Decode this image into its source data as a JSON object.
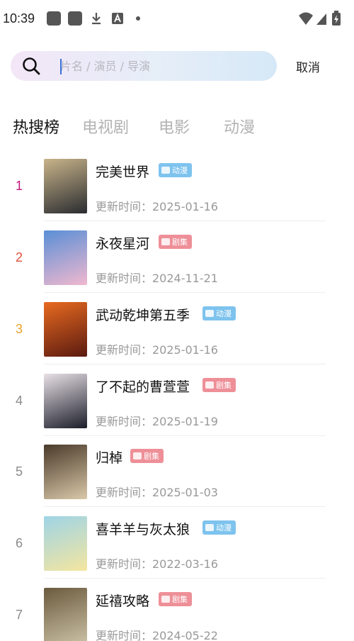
{
  "status_bar": {
    "time": "10:39",
    "icons": [
      "app-square-icon",
      "app-square-icon",
      "download-icon",
      "translate-icon",
      "dot-icon",
      "wifi-icon",
      "signal-icon",
      "battery-icon"
    ]
  },
  "search": {
    "placeholder": "片名 / 演员 / 导演",
    "value": "",
    "cancel_label": "取消"
  },
  "tabs": [
    {
      "label": "热搜榜",
      "active": true
    },
    {
      "label": "电视剧",
      "active": false
    },
    {
      "label": "电影",
      "active": false
    },
    {
      "label": "动漫",
      "active": false
    }
  ],
  "colors": {
    "rank_1": "#c2187a",
    "rank_2": "#e0503a",
    "rank_3": "#eba331",
    "rank_other": "#8a8a8a",
    "badge_anime": "#7ec3ee",
    "badge_series": "#ee8f98"
  },
  "items": [
    {
      "rank": "1",
      "title": "完美世界",
      "badge": "动漫",
      "badge_type": "anime",
      "updated": "更新时间：2025-01-16",
      "poster_colors": [
        "#2a2c30",
        "#c9b48a"
      ]
    },
    {
      "rank": "2",
      "title": "永夜星河",
      "badge": "剧集",
      "badge_type": "series",
      "updated": "更新时间：2024-11-21",
      "poster_colors": [
        "#f0b8cf",
        "#5a8fd6"
      ]
    },
    {
      "rank": "3",
      "title": "武动乾坤第五季",
      "badge": "动漫",
      "badge_type": "anime",
      "updated": "更新时间：2025-01-16",
      "poster_colors": [
        "#5a1a10",
        "#e86a20"
      ]
    },
    {
      "rank": "4",
      "title": "了不起的曹萱萱",
      "badge": "剧集",
      "badge_type": "series",
      "updated": "更新时间：2025-01-19",
      "poster_colors": [
        "#1c1e2a",
        "#e8e0e6"
      ]
    },
    {
      "rank": "5",
      "title": "归棹",
      "badge": "剧集",
      "badge_type": "series",
      "updated": "更新时间：2025-01-03",
      "poster_colors": [
        "#d9c8a8",
        "#4a3a2a"
      ]
    },
    {
      "rank": "6",
      "title": "喜羊羊与灰太狼",
      "badge": "动漫",
      "badge_type": "anime",
      "updated": "更新时间：2022-03-16",
      "poster_colors": [
        "#f4e6a0",
        "#9ed4e6"
      ]
    },
    {
      "rank": "7",
      "title": "延禧攻略",
      "badge": "剧集",
      "badge_type": "series",
      "updated": "更新时间：2024-05-22",
      "poster_colors": [
        "#c9bfa2",
        "#6b5a3e"
      ]
    }
  ]
}
